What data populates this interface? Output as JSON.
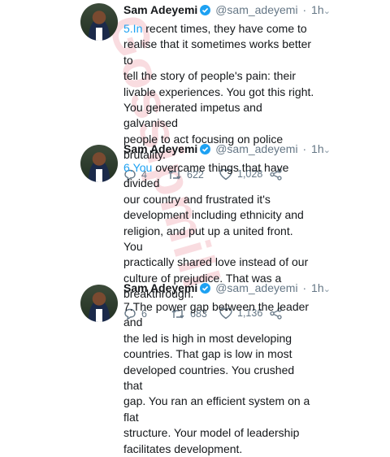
{
  "tweets": [
    {
      "name": "Sam Adeyemi",
      "handle": "@sam_adeyemi",
      "time": "1h",
      "number": "5.In",
      "lines": [
        " recent times, they have come to",
        "realise that it sometimes works better to",
        "tell the story of people's pain: their",
        "livable experiences. You got this right.",
        "You generated impetus and galvanised",
        "people to act focusing on police",
        "brutality."
      ],
      "replies": "4",
      "retweets": "622",
      "likes": "1,028"
    },
    {
      "name": "Sam Adeyemi",
      "handle": "@sam_adeyemi",
      "time": "1h",
      "number": "6.You",
      "lines": [
        " overcame things that have divided",
        "our country and frustrated it's",
        "development including ethnicity and",
        "religion, and put up a united front. You",
        "practically shared love instead of our",
        "culture of prejudice. That was a",
        "breakthrough."
      ],
      "replies": "6",
      "retweets": "683",
      "likes": "1,136"
    },
    {
      "name": "Sam Adeyemi",
      "handle": "@sam_adeyemi",
      "time": "1h",
      "number": "",
      "lines": [
        "7.The power gap between the leader and",
        "the led is high in most developing",
        "countries. That gap is low in most",
        "developed countries. You crushed that",
        "gap. You ran an efficient system on a flat",
        "structure. Your model of leadership",
        "facilitates development."
      ]
    }
  ],
  "watermark": "Gossipmill",
  "colors": {
    "link_blue": "#1da1f2",
    "muted": "#657786",
    "text": "#14171a"
  },
  "icons": [
    "verified-badge-icon",
    "chevron-down-icon",
    "reply-icon",
    "retweet-icon",
    "like-icon",
    "share-icon"
  ]
}
